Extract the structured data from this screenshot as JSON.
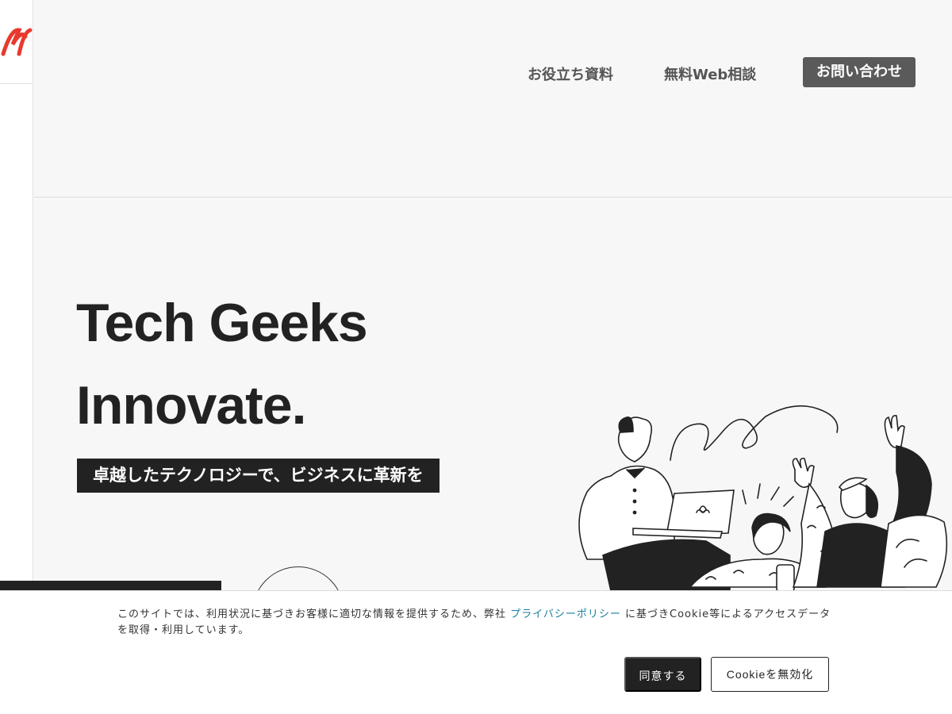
{
  "nav": {
    "resources": "お役立ち資料",
    "consult": "無料Web相談",
    "contact": "お問い合わせ"
  },
  "hero": {
    "title_line1": "Tech Geeks",
    "title_line2": "Innovate.",
    "tagline": "卓越したテクノロジーで、ビジネスに革新を"
  },
  "cookie": {
    "text_before": "このサイトでは、利用状況に基づきお客様に適切な情報を提供するため、弊社 ",
    "link": "プライバシーポリシー",
    "text_after": " に基づきCookie等によるアクセスデータを取得・利用しています。",
    "agree": "同意する",
    "disable": "Cookieを無効化"
  },
  "colors": {
    "brand_red": "#e8392f",
    "dark": "#222222",
    "contact_button": "#5a5a5a",
    "link": "#1a7fa0"
  },
  "icons": {
    "logo": "brand-logo-icon",
    "illustration": "people-celebrating-illustration"
  }
}
